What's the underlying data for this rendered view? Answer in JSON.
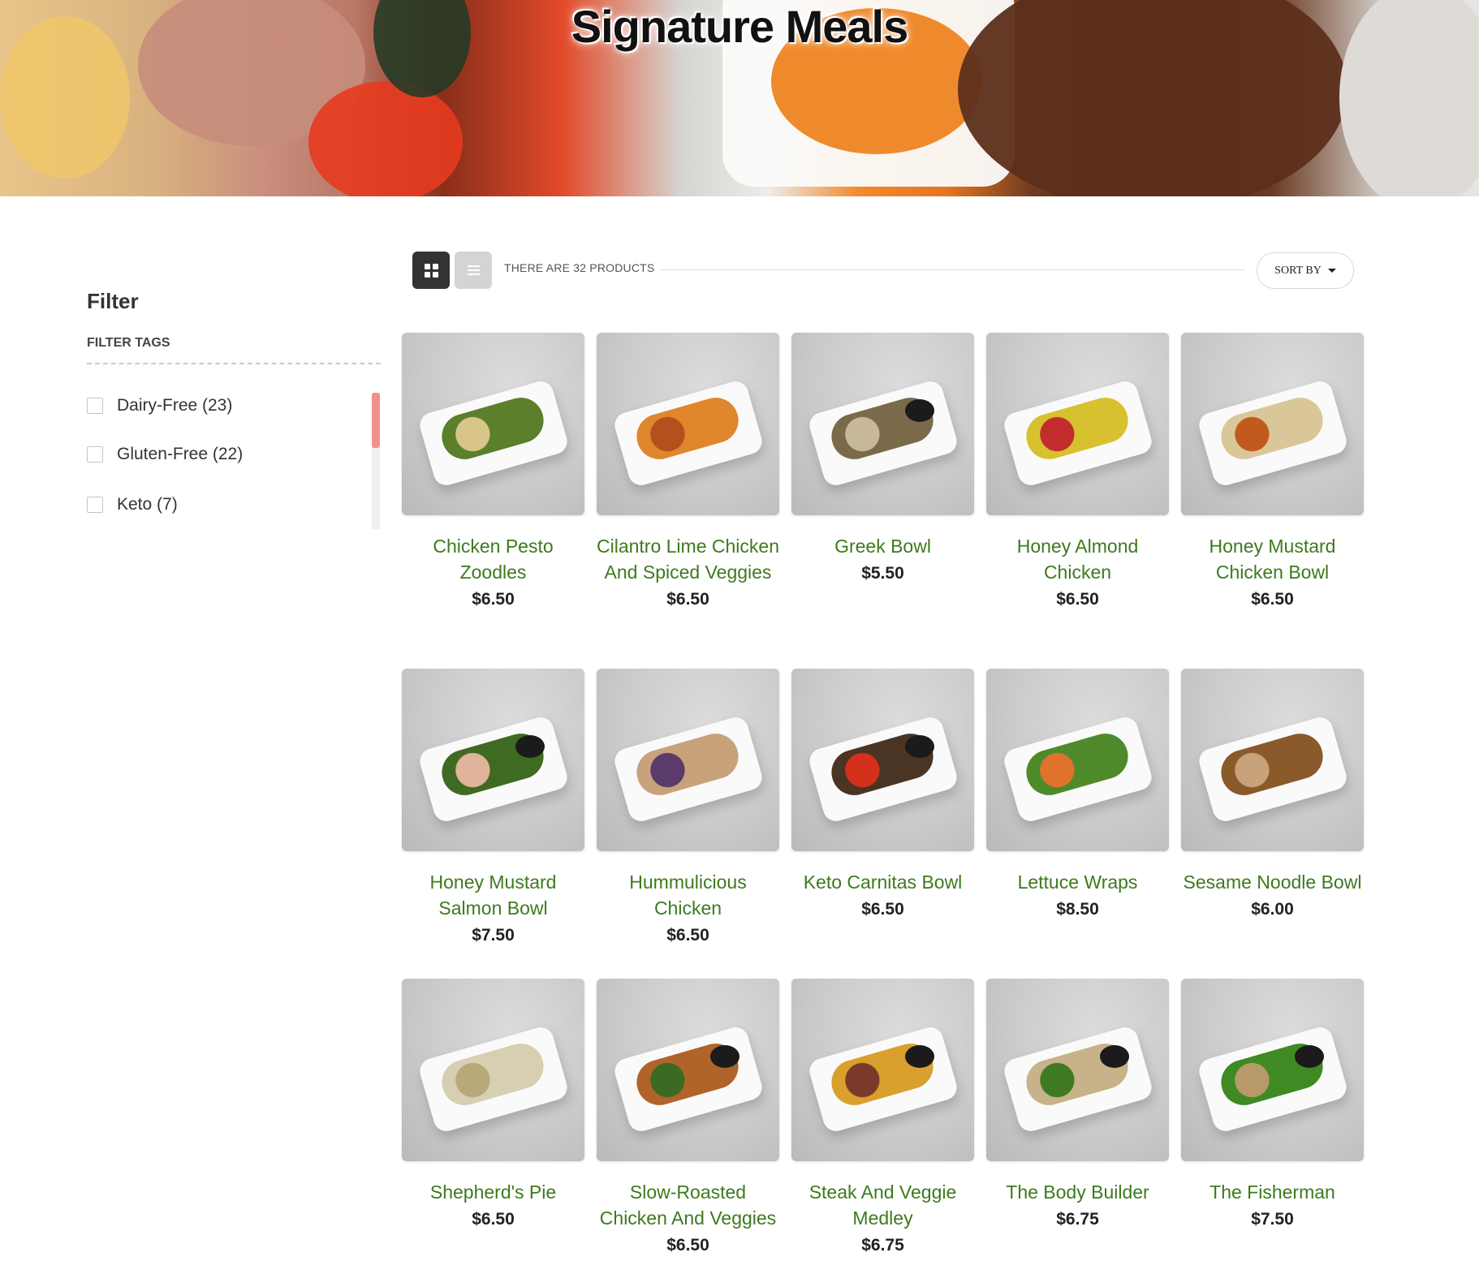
{
  "hero": {
    "title": "Signature Meals"
  },
  "filter": {
    "title": "Filter",
    "section_label": "FILTER TAGS",
    "options": [
      {
        "label": "Dairy-Free (23)",
        "checked": false
      },
      {
        "label": "Gluten-Free (22)",
        "checked": false
      },
      {
        "label": "Keto (7)",
        "checked": false
      }
    ]
  },
  "toolbar": {
    "count_text": "THERE ARE 32 PRODUCTS",
    "sort_label": "SORT BY",
    "grid_icon": "grid-view-icon",
    "list_icon": "list-view-icon"
  },
  "products": [
    {
      "name": "Chicken Pesto Zoodles",
      "price": "$6.50",
      "food_color": "#5b7f2a",
      "accent": "#d9c58a",
      "cup": false
    },
    {
      "name": "Cilantro Lime Chicken And Spiced Veggies",
      "price": "$6.50",
      "food_color": "#e0862c",
      "accent": "#b3501c",
      "cup": false
    },
    {
      "name": "Greek Bowl",
      "price": "$5.50",
      "food_color": "#7b6a4a",
      "accent": "#c8b89a",
      "cup": true
    },
    {
      "name": "Honey Almond Chicken",
      "price": "$6.50",
      "food_color": "#d8c12e",
      "accent": "#c22c2c",
      "cup": false
    },
    {
      "name": "Honey Mustard Chicken Bowl",
      "price": "$6.50",
      "food_color": "#d9c79a",
      "accent": "#c25a1e",
      "cup": false
    },
    {
      "name": "Honey Mustard Salmon Bowl",
      "price": "$7.50",
      "food_color": "#3f6a22",
      "accent": "#e0b49a",
      "cup": true
    },
    {
      "name": "Hummulicious Chicken",
      "price": "$6.50",
      "food_color": "#c8a27a",
      "accent": "#5a3b6a",
      "cup": false
    },
    {
      "name": "Keto Carnitas Bowl",
      "price": "$6.50",
      "food_color": "#4a3424",
      "accent": "#d4301c",
      "cup": true
    },
    {
      "name": "Lettuce Wraps",
      "price": "$8.50",
      "food_color": "#4f8a2a",
      "accent": "#e0722c",
      "cup": false
    },
    {
      "name": "Sesame Noodle Bowl",
      "price": "$6.00",
      "food_color": "#8a5a2a",
      "accent": "#c8a27a",
      "cup": false
    },
    {
      "name": "Shepherd's Pie",
      "price": "$6.50",
      "food_color": "#d7cfb2",
      "accent": "#b8a87a",
      "cup": false
    },
    {
      "name": "Slow-Roasted Chicken And Veggies",
      "price": "$6.50",
      "food_color": "#b0642a",
      "accent": "#3c6a22",
      "cup": true
    },
    {
      "name": "Steak And Veggie Medley",
      "price": "$6.75",
      "food_color": "#d9a02e",
      "accent": "#7a3a2a",
      "cup": true
    },
    {
      "name": "The Body Builder",
      "price": "$6.75",
      "food_color": "#c8b28a",
      "accent": "#3f7a22",
      "cup": true
    },
    {
      "name": "The Fisherman",
      "price": "$7.50",
      "food_color": "#3f8a22",
      "accent": "#b89a6a",
      "cup": true
    }
  ]
}
